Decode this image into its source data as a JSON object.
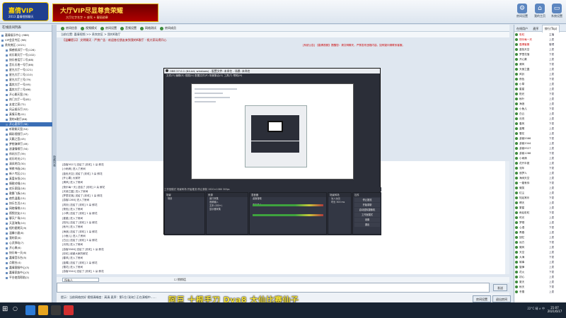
{
  "app": {
    "logo_text": "嘉倩VIP",
    "logo_sub": "2013 嘉倩视频聊天",
    "banner_title": "大厅VIP尽显尊贵荣耀",
    "banner_sub": "大厅红字名字 + 座驾 + 靓丽勋章",
    "header_buttons": [
      {
        "label": "房间设置"
      },
      {
        "label": "我的主页"
      },
      {
        "label": "系统设置"
      }
    ]
  },
  "left_panel": {
    "title": "在线房间列表",
    "items": [
      "嘉倩娱乐中心 (986)",
      "VIP会员专区 (98)",
      "贵宾房区 (1021)",
      "情感倾诉厅一号(126)",
      "欢乐聊天厅一号(102)",
      "快乐夜话厅二号(88)",
      "音乐天地一号厅(86)",
      "星光大厅一号(121)",
      "星光大厅二号(110)",
      "星光大厅三号(79)",
      "嘉宾大厅一号(95)",
      "嘉宾大厅二号(66)",
      "开心聊天室(78)",
      "热门大厅一号(81)",
      "友谊之家(72)",
      "风云娱乐厅(52)",
      "真情天地(41)",
      "我的K歌厅(86)",
      "开心麦序厅(38)",
      "听歌聊天室(54)",
      "精彩视频厅(47)",
      "天籁之音(43)",
      "梦想演绎厅(49)",
      "浪漫情缘厅(34)",
      "休闲大厅(39)",
      "欢乐时光(27)",
      "清风明月(30)",
      "琴棋书画(28)",
      "新人专区(21)",
      "真爱永恒(20)",
      "情歌对唱(19)",
      "欢乐家园(18)",
      "歌舞飞扬(16)",
      "夜色温柔(15)",
      "快乐生活(14)",
      "网络情缘(12)",
      "视频交友(11)",
      "聊天广场(10)",
      "天涯海角(10)",
      "相约星期天(9)",
      "温馨小屋(8)",
      "我的家(8)",
      "心灵驿站(7)",
      "开心果(6)",
      "快乐每一天(6)",
      "嘉倩音乐台(5)",
      "点歌台(4)",
      "嘉倩客服中心(3)",
      "嘉倩家族中心(3)",
      "平台使用帮助(2)"
    ],
    "selected_index": 18,
    "splitter_label": "隐藏列表"
  },
  "toolbar": {
    "buttons": [
      "房间信息",
      "视频模式",
      "房间设置",
      "音频设置",
      "网络测试",
      "房间成员"
    ]
  },
  "breadcrumb": "当前位置: 嘉倩视频 >> 贵宾房区 > 我的K歌厅",
  "room_title": "【温馨提示】 文明聊天 · 严禁广告 · 欢迎各位朋友来到我的K歌厅 · 祝大家玩得开心",
  "notice": "[系统公告] 【嘉倩视频】提醒您：请文明聊天，严禁发布违规内容。如有疑问请联系客服。",
  "chat": {
    "lines": [
      "[游客9527] 送给了 [彩虹] 1 朵 鲜花",
      "[小雨滴] 进入了房间",
      "[蓝色天空] 送给了 [彩虹] 3 朵 鲜花",
      "[开心果] 大家好",
      "[清风] 进入了房间",
      "[快乐每一天] 送给了 [彩虹] 2 朵 鲜花",
      "[天使之翼] 进入了房间",
      "[梦里花落] 送给了 [彩虹] 1 朵 鲜花",
      "[游客1288] 进入了房间",
      "[风铃] 送给了 [彩虹] 5 朵 鲜花",
      "[夜色] 进入了房间",
      "[小草] 送给了 [彩虹] 1 朵 鲜花",
      "[星星] 进入了房间",
      "[阳光] 送给了 [彩虹] 2 朵 鲜花",
      "[秋叶] 进入了房间",
      "[海浪] 送给了 [彩虹] 1 朵 鲜花",
      "[小鱼儿] 进入了房间",
      "[白云] 送给了 [彩虹] 3 朵 鲜花",
      "[月亮] 进入了房间",
      "[游客5566] 送给了 [彩虹] 1 朵 鲜花",
      "[彩虹] 谢谢大家的鲜花",
      "[春风] 进入了房间",
      "[蓝莓] 送给了 [彩虹] 2 朵 鲜花",
      "[雪花] 进入了房间",
      "[游客3344] 送给了 [彩虹] 1 朵 鲜花"
    ]
  },
  "input_row": {
    "target": "所有人",
    "private_label": "悄悄话"
  },
  "send_button": "发送",
  "status_text": "提示：当前网络良好  视频清晰度：高清  麦序：第1位 [彩虹]  正在演唱中……",
  "right_panel": {
    "tabs": [
      "在线用户",
      "麦序",
      "排行(Top)"
    ],
    "active_tab": 2,
    "users": [
      {
        "name": "彩虹",
        "status": "主播"
      },
      {
        "name": "快乐每一天",
        "status": "上麦"
      },
      {
        "name": "嘉倩客服",
        "status": "管理"
      },
      {
        "name": "蓝色天空",
        "status": "上麦"
      },
      {
        "name": "梦里花落",
        "status": "下麦"
      },
      {
        "name": "开心果",
        "status": "上麦"
      },
      {
        "name": "清风",
        "status": "下麦"
      },
      {
        "name": "天使之翼",
        "status": "上麦"
      },
      {
        "name": "风铃",
        "status": "上麦"
      },
      {
        "name": "夜色",
        "status": "下麦"
      },
      {
        "name": "小草",
        "status": "上麦"
      },
      {
        "name": "星星",
        "status": "上麦"
      },
      {
        "name": "阳光",
        "status": "下麦"
      },
      {
        "name": "秋叶",
        "status": "上麦"
      },
      {
        "name": "海浪",
        "status": "上麦"
      },
      {
        "name": "小鱼儿",
        "status": "下麦"
      },
      {
        "name": "白云",
        "status": "上麦"
      },
      {
        "name": "月亮",
        "status": "上麦"
      },
      {
        "name": "春风",
        "status": "下麦"
      },
      {
        "name": "蓝莓",
        "status": "上麦"
      },
      {
        "name": "雪花",
        "status": "上麦"
      },
      {
        "name": "游客5566",
        "status": "下麦"
      },
      {
        "name": "游客3344",
        "status": "上麦"
      },
      {
        "name": "游客9527",
        "status": "上麦"
      },
      {
        "name": "游客1288",
        "status": "下麦"
      },
      {
        "name": "小雨滴",
        "status": "上麦"
      },
      {
        "name": "花开半夏",
        "status": "上麦"
      },
      {
        "name": "流年",
        "status": "下麦"
      },
      {
        "name": "追梦人",
        "status": "上麦"
      },
      {
        "name": "海阔天空",
        "status": "上麦"
      },
      {
        "name": "一路有你",
        "status": "下麦"
      },
      {
        "name": "微笑",
        "status": "上麦"
      },
      {
        "name": "红尘",
        "status": "上麦"
      },
      {
        "name": "知足常乐",
        "status": "下麦"
      },
      {
        "name": "晴天",
        "status": "上麦"
      },
      {
        "name": "繁星",
        "status": "上麦"
      },
      {
        "name": "雨后彩虹",
        "status": "下麦"
      },
      {
        "name": "时光",
        "status": "上麦"
      },
      {
        "name": "梦想",
        "status": "上麦"
      },
      {
        "name": "心语",
        "status": "下麦"
      },
      {
        "name": "青春",
        "status": "上麦"
      },
      {
        "name": "回忆",
        "status": "上麦"
      },
      {
        "name": "远方",
        "status": "下麦"
      },
      {
        "name": "微风",
        "status": "上麦"
      },
      {
        "name": "天空",
        "status": "上麦"
      },
      {
        "name": "大海",
        "status": "下麦"
      },
      {
        "name": "故事",
        "status": "上麦"
      },
      {
        "name": "旋律",
        "status": "上麦"
      },
      {
        "name": "花火",
        "status": "下麦"
      },
      {
        "name": "初心",
        "status": "上麦"
      },
      {
        "name": "夏天",
        "status": "上麦"
      },
      {
        "name": "秋天",
        "status": "下麦"
      },
      {
        "name": "冬雪",
        "status": "上麦"
      }
    ]
  },
  "room_button": "房间设置",
  "exit_button": "退出房间",
  "obs": {
    "title": "OBS 27.0.1 (64-bit, windows) - 配置文件: 未命名 - 场景: 未命名",
    "menu": [
      "文件(F)",
      "编辑(E)",
      "视图(V)",
      "配置文件(P)",
      "场景集合(S)",
      "工具(T)",
      "帮助(H)"
    ],
    "controls_bar": "工作室模式    场景转场    开始推流    停止录制    1920×1080 30fps",
    "docks": {
      "scenes_title": "场景",
      "scenes": [
        "场景"
      ],
      "sources_title": "来源",
      "sources": [
        "窗口采集",
        "音频输入",
        "文本 (GDI+)",
        "显示器采集"
      ],
      "mixer_title": "混音器",
      "mixer_channels": [
        "桌面音频",
        "麦克风/Aux"
      ],
      "transition_title": "场景转场",
      "transition_value": "淡入淡出",
      "duration_label": "时长",
      "duration_value": "300 ms",
      "controls_title": "控件",
      "controls": [
        "停止推流",
        "开始录制",
        "启动虚拟摄像机",
        "工作室模式",
        "设置",
        "退出"
      ]
    }
  },
  "overlay_text": "阿巨 十根手刀 Dva8 大仙比赛仙子",
  "taskbar": {
    "tray_text": "22°C  晴  ∧  中",
    "clock_time": "21:07",
    "clock_date": "2021/6/17"
  }
}
